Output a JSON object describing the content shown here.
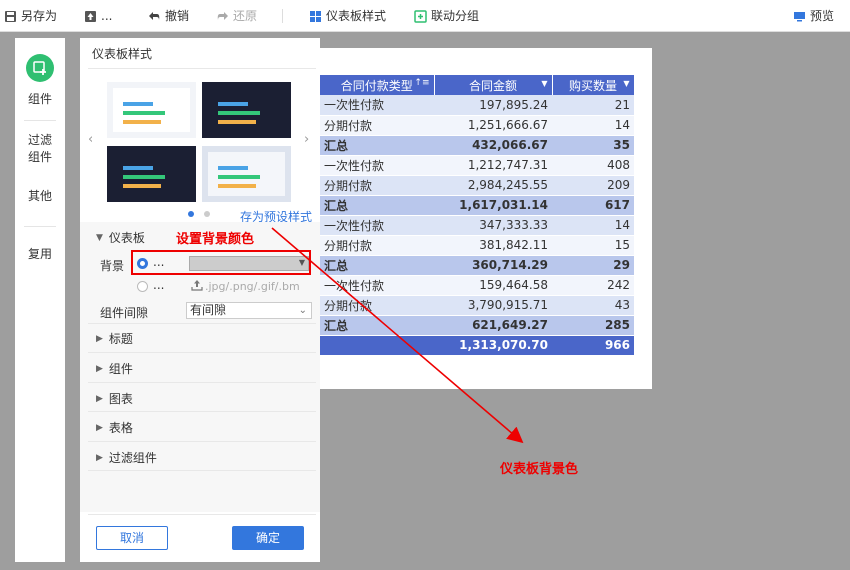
{
  "toolbar": {
    "save_as": "另存为",
    "more": "...",
    "undo": "撤销",
    "redo": "还原",
    "dashboard_style": "仪表板样式",
    "link_group": "联动分组",
    "preview": "预览"
  },
  "rail": {
    "components": "组件",
    "filter_line1": "过滤",
    "filter_line2": "组件",
    "other": "其他",
    "reuse": "复用"
  },
  "panel": {
    "title": "仪表板样式",
    "save_preset": "存为预设样式",
    "dashboard_section": "仪表板",
    "background_label": "背景",
    "bg_option_color": "...",
    "bg_option_image": "...",
    "upload_hint": ".jpg/.png/.gif/.bm",
    "gap_label": "组件间隙",
    "gap_value": "有间隙",
    "sections": [
      "标题",
      "组件",
      "图表",
      "表格",
      "过滤组件"
    ],
    "cancel": "取消",
    "confirm": "确定"
  },
  "annotations": {
    "set_bg_color": "设置背景颜色",
    "dashboard_bg_color": "仪表板背景色"
  },
  "table": {
    "headers": [
      "合同付款类型",
      "合同金额",
      "购买数量"
    ],
    "rows": [
      {
        "type": "一次性付款",
        "amount": "197,895.24",
        "qty": "21",
        "kind": "odd"
      },
      {
        "type": "分期付款",
        "amount": "1,251,666.67",
        "qty": "14",
        "kind": "even"
      },
      {
        "type": "汇总",
        "amount": "432,066.67",
        "qty": "35",
        "kind": "sub"
      },
      {
        "type": "一次性付款",
        "amount": "1,212,747.31",
        "qty": "408",
        "kind": "even"
      },
      {
        "type": "分期付款",
        "amount": "2,984,245.55",
        "qty": "209",
        "kind": "odd"
      },
      {
        "type": "汇总",
        "amount": "1,617,031.14",
        "qty": "617",
        "kind": "sub"
      },
      {
        "type": "一次性付款",
        "amount": "347,333.33",
        "qty": "14",
        "kind": "odd"
      },
      {
        "type": "分期付款",
        "amount": "381,842.11",
        "qty": "15",
        "kind": "even"
      },
      {
        "type": "汇总",
        "amount": "360,714.29",
        "qty": "29",
        "kind": "sub"
      },
      {
        "type": "一次性付款",
        "amount": "159,464.58",
        "qty": "242",
        "kind": "even"
      },
      {
        "type": "分期付款",
        "amount": "3,790,915.71",
        "qty": "43",
        "kind": "odd"
      },
      {
        "type": "汇总",
        "amount": "621,649.27",
        "qty": "285",
        "kind": "sub"
      },
      {
        "type": "",
        "amount": "1,313,070.70",
        "qty": "966",
        "kind": "total"
      }
    ]
  },
  "colors": {
    "accent": "#3377dd",
    "table_header": "#4a66c9",
    "annotation": "#e00000",
    "rail_icon": "#2fbf71"
  }
}
